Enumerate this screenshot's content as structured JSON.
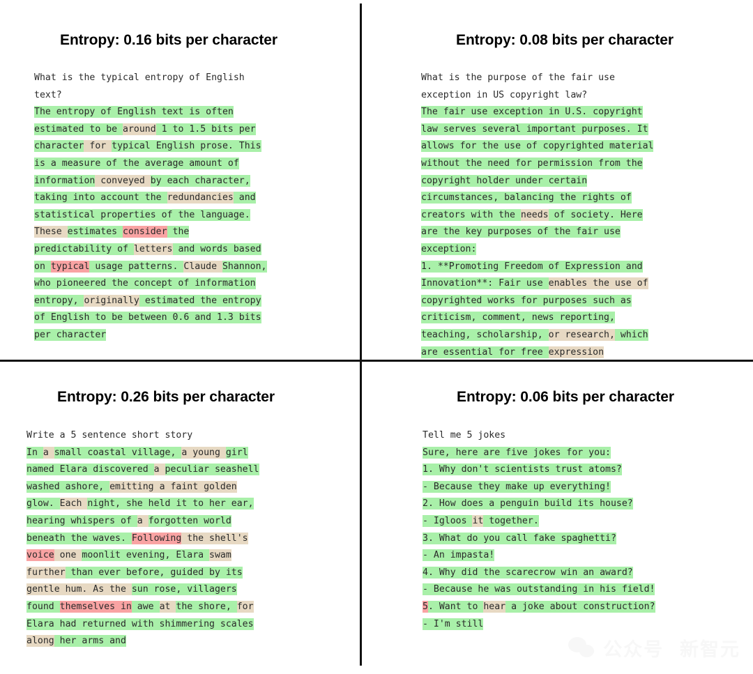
{
  "figure": {
    "legend": {
      "high_color": "#a9f0a9",
      "mid_color": "#e7d9c3",
      "low_color": "#f9a3a3",
      "plain_color": "#ffffff",
      "text_color": "#2a2a2a",
      "divider_color": "#111111"
    }
  },
  "watermark": {
    "logo_name": "wechat-logo",
    "text": "公众号  新智元"
  },
  "panels": [
    {
      "id": "top-left",
      "title": "Entropy: 0.16 bits per character",
      "entropy": 0.16,
      "prompt": "What is the typical entropy of English text?",
      "tokens": [
        {
          "t": "What is the typical entropy of English\ntext?\n",
          "c": "plain"
        },
        {
          "t": "The entropy of English text is often\nestimated",
          "c": "high"
        },
        {
          "t": " to be ",
          "c": "high"
        },
        {
          "t": "around",
          "c": "mid"
        },
        {
          "t": " 1 to 1.5 bits per\ncharacter",
          "c": "high"
        },
        {
          "t": " for ",
          "c": "mid"
        },
        {
          "t": "typical English prose. This\nis a measure of the average amount of\ninformation",
          "c": "high"
        },
        {
          "t": " conveyed ",
          "c": "mid"
        },
        {
          "t": "by each character,\ntaking into account the ",
          "c": "high"
        },
        {
          "t": "redundancies",
          "c": "mid"
        },
        {
          "t": " and\nstatistical properties ",
          "c": "high"
        },
        {
          "t": "of the language.\n",
          "c": "high"
        },
        {
          "t": "These ",
          "c": "mid"
        },
        {
          "t": "estimates ",
          "c": "high"
        },
        {
          "t": "consider",
          "c": "low"
        },
        {
          "t": " the\npredictability of ",
          "c": "high"
        },
        {
          "t": "letters",
          "c": "mid"
        },
        {
          "t": " and words based\non ",
          "c": "high"
        },
        {
          "t": "typical",
          "c": "low"
        },
        {
          "t": " usage patterns. ",
          "c": "high"
        },
        {
          "t": "Claude ",
          "c": "mid"
        },
        {
          "t": "Shannon,\nwho pioneered the concept of information\nentropy, ",
          "c": "high"
        },
        {
          "t": "originally",
          "c": "mid"
        },
        {
          "t": " estimated the entropy\nof English to be between 0.6 and 1.3 bits\nper character",
          "c": "high"
        }
      ]
    },
    {
      "id": "top-right",
      "title": "Entropy: 0.08 bits per character",
      "entropy": 0.08,
      "prompt": "What is the purpose of the fair use exception in US copyright law?",
      "tokens": [
        {
          "t": "What is the purpose of the fair use\nexception in US copyright law?\n",
          "c": "plain"
        },
        {
          "t": "The fair use exception in U.S. copyright\nlaw serves several important purposes. It\nallows for the use of copyrighted material\nwithout the need for permission from the\ncopyright holder under certain\ncircumstances, balancing the rights of\ncreators with the ",
          "c": "high"
        },
        {
          "t": "needs",
          "c": "mid"
        },
        {
          "t": " of society. Here\nare the key purposes of the fair use\nexception:\n1. **Promoting Freedom of Expression and\nInnovation**: Fair use ",
          "c": "high"
        },
        {
          "t": "enables the use of",
          "c": "mid"
        },
        {
          "t": "\ncopyrighted works for purposes such as\ncriticism, comment, news reporting,\nteaching, scholarship, ",
          "c": "high"
        },
        {
          "t": "or research,",
          "c": "mid"
        },
        {
          "t": " which\nare essential for free ",
          "c": "high"
        },
        {
          "t": "expression",
          "c": "mid"
        }
      ]
    },
    {
      "id": "bottom-left",
      "title": "Entropy: 0.26 bits per character",
      "entropy": 0.26,
      "prompt": "Write a 5 sentence short story",
      "tokens": [
        {
          "t": "Write a 5 sentence short story\n",
          "c": "plain"
        },
        {
          "t": "In ",
          "c": "high"
        },
        {
          "t": "a ",
          "c": "mid"
        },
        {
          "t": "small coastal village, ",
          "c": "high"
        },
        {
          "t": "a young ",
          "c": "mid"
        },
        {
          "t": "girl\nnamed Elara discovered ",
          "c": "high"
        },
        {
          "t": "a ",
          "c": "mid"
        },
        {
          "t": "peculiar seashell\nwashed ashore, ",
          "c": "high"
        },
        {
          "t": "emitting",
          "c": "mid"
        },
        {
          "t": " a faint ",
          "c": "mid"
        },
        {
          "t": "golden\n",
          "c": "mid"
        },
        {
          "t": "glow. ",
          "c": "high"
        },
        {
          "t": "Each ",
          "c": "mid"
        },
        {
          "t": "night, she held it to her ear,\nhearing whispers of ",
          "c": "high"
        },
        {
          "t": "a ",
          "c": "mid"
        },
        {
          "t": "forgotten world\nbeneath the waves. ",
          "c": "high"
        },
        {
          "t": "Following",
          "c": "low"
        },
        {
          "t": " the shell's\n",
          "c": "mid"
        },
        {
          "t": "voice",
          "c": "low"
        },
        {
          "t": " one ",
          "c": "mid"
        },
        {
          "t": "moonlit evening, Elara ",
          "c": "high"
        },
        {
          "t": "swam\n",
          "c": "mid"
        },
        {
          "t": "further",
          "c": "mid"
        },
        {
          "t": " than ever before, guided by its\n",
          "c": "high"
        },
        {
          "t": "gentle hum. As ",
          "c": "mid"
        },
        {
          "t": "the ",
          "c": "mid"
        },
        {
          "t": "sun rose, villagers\n",
          "c": "high"
        },
        {
          "t": "found ",
          "c": "high"
        },
        {
          "t": "themselves in",
          "c": "low"
        },
        {
          "t": " awe ",
          "c": "high"
        },
        {
          "t": "at ",
          "c": "mid"
        },
        {
          "t": "the shore, ",
          "c": "high"
        },
        {
          "t": "for\n",
          "c": "mid"
        },
        {
          "t": "Elara had returned with shimmering scales\n",
          "c": "high"
        },
        {
          "t": "along",
          "c": "mid"
        },
        {
          "t": " her arms and",
          "c": "high"
        }
      ]
    },
    {
      "id": "bottom-right",
      "title": "Entropy: 0.06 bits per character",
      "entropy": 0.06,
      "prompt": "Tell me 5 jokes",
      "tokens": [
        {
          "t": "Tell me 5 jokes\n",
          "c": "plain"
        },
        {
          "t": "Sure, here are five jokes for you:\n1. Why don't scientists trust atoms?\n- Because they make up everything!\n2. How does a penguin build its house?\n- Igloos ",
          "c": "high"
        },
        {
          "t": "it",
          "c": "mid"
        },
        {
          "t": " together.\n3. What do you call fake spaghetti?\n- An impasta!\n4. Why did the scarecrow win an award?\n- Because he was outstanding in his field!\n",
          "c": "high"
        },
        {
          "t": "5",
          "c": "low"
        },
        {
          "t": ". Want to ",
          "c": "high"
        },
        {
          "t": "hear",
          "c": "mid"
        },
        {
          "t": " a joke about construction?\n- I'm still",
          "c": "high"
        }
      ]
    }
  ]
}
